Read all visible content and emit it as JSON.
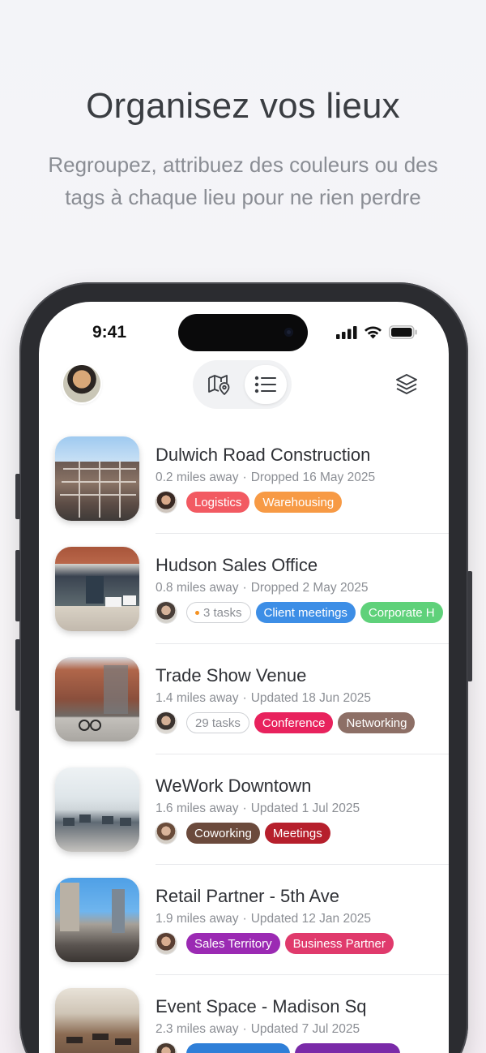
{
  "promo": {
    "title": "Organisez vos lieux",
    "subtitle": "Regroupez, attribuez des couleurs ou des tags à chaque lieu pour ne rien perdre"
  },
  "status_bar": {
    "time": "9:41"
  },
  "toolbar": {
    "view_toggle": {
      "options": [
        "map-view-icon",
        "list-view-icon"
      ],
      "selected": "list"
    }
  },
  "places": [
    {
      "name": "Dulwich Road Construction",
      "distance": "0.2 miles away",
      "status": "Dropped",
      "date": "16 May 2025",
      "tags": [
        {
          "label": "Logistics",
          "color": "#f25a62"
        },
        {
          "label": "Warehousing",
          "color": "#f79a45"
        }
      ]
    },
    {
      "name": "Hudson Sales Office",
      "distance": "0.8 miles away",
      "status": "Dropped",
      "date": "2 May 2025",
      "tasks": "3 tasks",
      "tags": [
        {
          "label": "Client meetings",
          "color": "#3d8ee6"
        },
        {
          "label": "Corporate H",
          "color": "#5fd17a"
        }
      ]
    },
    {
      "name": "Trade Show Venue",
      "distance": "1.4 miles away",
      "status": "Updated",
      "date": "18 Jun 2025",
      "tasks": "29 tasks",
      "tags": [
        {
          "label": "Conference",
          "color": "#e8225d"
        },
        {
          "label": "Networking",
          "color": "#8d6f66"
        }
      ]
    },
    {
      "name": "WeWork Downtown",
      "distance": "1.6 miles away",
      "status": "Updated",
      "date": "1 Jul 2025",
      "tags": [
        {
          "label": "Coworking",
          "color": "#6b4a3c"
        },
        {
          "label": "Meetings",
          "color": "#b61f2c"
        }
      ]
    },
    {
      "name": "Retail Partner - 5th Ave",
      "distance": "1.9 miles away",
      "status": "Updated",
      "date": "12 Jan 2025",
      "tags": [
        {
          "label": "Sales Territory",
          "color": "#9b2ab3"
        },
        {
          "label": "Business Partner",
          "color": "#e03a6c"
        }
      ]
    },
    {
      "name": "Event Space - Madison Sq",
      "distance": "2.3 miles away",
      "status": "Updated",
      "date": "7 Jul 2025",
      "tags": [
        {
          "label": "",
          "color": "#2f7fd8"
        },
        {
          "label": "",
          "color": "#7a2aa8"
        }
      ]
    }
  ]
}
